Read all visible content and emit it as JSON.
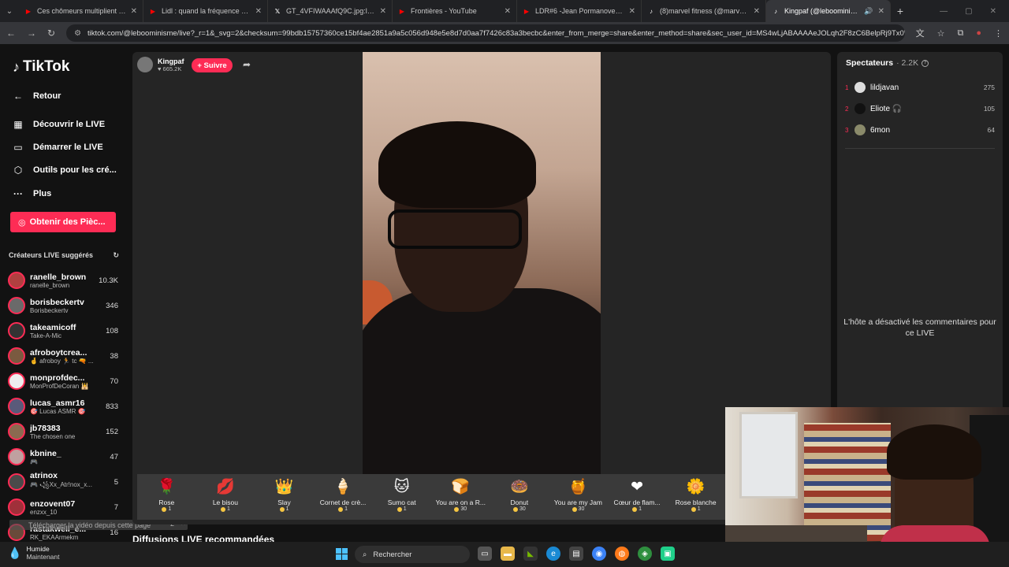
{
  "browser": {
    "tabs": [
      {
        "title": "Ces chômeurs multiplient les ca",
        "icon": "youtube-icon",
        "color": "#ff0000"
      },
      {
        "title": "Lidl : quand la fréquence de tra",
        "icon": "youtube-icon",
        "color": "#ff0000"
      },
      {
        "title": "GT_4VFIWAAAfQ9C.jpg:large (",
        "icon": "x-icon",
        "color": "#ffffff"
      },
      {
        "title": "Frontières - YouTube",
        "icon": "youtube-icon",
        "color": "#ff0000"
      },
      {
        "title": "LDR#6 -Jean Pormanove - Enq",
        "icon": "youtube-icon",
        "color": "#ff0000"
      },
      {
        "title": "(8)marvel fitness (@marvel.fit) |",
        "icon": "tiktok-icon",
        "color": "#ffffff"
      },
      {
        "title": "Kingpaf (@leboominisme) ",
        "icon": "tiktok-icon",
        "color": "#ffffff"
      }
    ],
    "url": "tiktok.com/@leboominisme/live?_r=1&_svg=2&checksum=99bdb15757360ce15bf4ae2851a9a5c056d948e5e8d7d0aa7f7426c83a3becbc&enter_from_merge=share&enter_method=share&sec_user_id=MS4wLjABAAAAeJOLqh2F8zC6BelpRj9Tx0W9M..."
  },
  "sidebar": {
    "logo": "TikTok",
    "nav": [
      {
        "label": "Retour",
        "icon": "back-arrow-icon",
        "glyph": "←"
      },
      {
        "label": "Découvrir le LIVE",
        "icon": "calendar-icon",
        "glyph": "▦"
      },
      {
        "label": "Démarrer le LIVE",
        "icon": "camera-icon",
        "glyph": "▭"
      },
      {
        "label": "Outils pour les cré...",
        "icon": "play-icon",
        "glyph": "⬡"
      },
      {
        "label": "Plus",
        "icon": "more-icon",
        "glyph": "···"
      }
    ],
    "coins_button": "Obtenir des Pièc...",
    "suggested_title": "Créateurs LIVE suggérés",
    "creators": [
      {
        "name": "ranelle_brown",
        "sub": "ranelle_brown",
        "count": "10.3K",
        "color": "#b04040"
      },
      {
        "name": "borisbeckertv",
        "sub": "Borisbeckertv",
        "count": "346",
        "color": "#6a6a6a"
      },
      {
        "name": "takeamicoff",
        "sub": "Take-A-Mic",
        "count": "108",
        "color": "#333333"
      },
      {
        "name": "afroboytcrea...",
        "sub": "🤞 afroboy 🏃 tc 🔫 ...",
        "count": "38",
        "color": "#7a5a40"
      },
      {
        "name": "monprofdec...",
        "sub": "MonProfDeCoran 🕌",
        "count": "70",
        "color": "#eeeeee"
      },
      {
        "name": "lucas_asmr16",
        "sub": "🎯 Lucas ASMR 🎯",
        "count": "833",
        "color": "#5a5a7a"
      },
      {
        "name": "jb78383",
        "sub": "The chosen one",
        "count": "152",
        "color": "#8a6a50"
      },
      {
        "name": "kbnine_",
        "sub": "🎮",
        "count": "47",
        "color": "#c0a0a0"
      },
      {
        "name": "atrinox",
        "sub": "🎮 ꧁Xx_Atr!nox_x...",
        "count": "5",
        "color": "#4a4a4a"
      },
      {
        "name": "enzovent07",
        "sub": "enzxx_10",
        "count": "7",
        "color": "#a0303a"
      },
      {
        "name": "rastakwell_e...",
        "sub": "RK_EKAArmekm",
        "count": "16",
        "color": "#6a4a3a"
      }
    ],
    "popup_text": "Télécharger la vidéo depuis cette page",
    "popup_count": "2"
  },
  "stream": {
    "host_name": "Kingpaf",
    "host_likes": "665.2K",
    "follow_label": "+ Suivre",
    "gifts": [
      {
        "name": "Rose",
        "price": "1",
        "glyph": "🌹"
      },
      {
        "name": "Le bisou",
        "price": "1",
        "glyph": "💋"
      },
      {
        "name": "Slay",
        "price": "1",
        "glyph": "👑"
      },
      {
        "name": "Cornet de crè...",
        "price": "1",
        "glyph": "🍦"
      },
      {
        "name": "Sumo cat",
        "price": "1",
        "glyph": "🐱"
      },
      {
        "name": "You are on a R...",
        "price": "30",
        "glyph": "🍞"
      },
      {
        "name": "Donut",
        "price": "30",
        "glyph": "🍩"
      },
      {
        "name": "You are my Jam",
        "price": "30",
        "glyph": "🍯"
      },
      {
        "name": "Cœur de flam...",
        "price": "1",
        "glyph": "❤"
      },
      {
        "name": "Rose blanche",
        "price": "1",
        "glyph": "🌼"
      }
    ],
    "recommended_title": "Diffusions LIVE recommandées"
  },
  "viewers": {
    "title": "Spectateurs",
    "count": "· 2.2K",
    "list": [
      {
        "rank": "1",
        "name": "lildjavan",
        "score": "275",
        "color": "#dddddd"
      },
      {
        "rank": "2",
        "name": "Eliote 🎧",
        "score": "105",
        "color": "#111111"
      },
      {
        "rank": "3",
        "name": "6mon",
        "score": "64",
        "color": "#8a8a6a"
      }
    ],
    "comments_disabled": "L'hôte a désactivé les commentaires pour ce LIVE"
  },
  "taskbar": {
    "weather_title": "Humide",
    "weather_sub": "Maintenant",
    "search_placeholder": "Rechercher"
  }
}
